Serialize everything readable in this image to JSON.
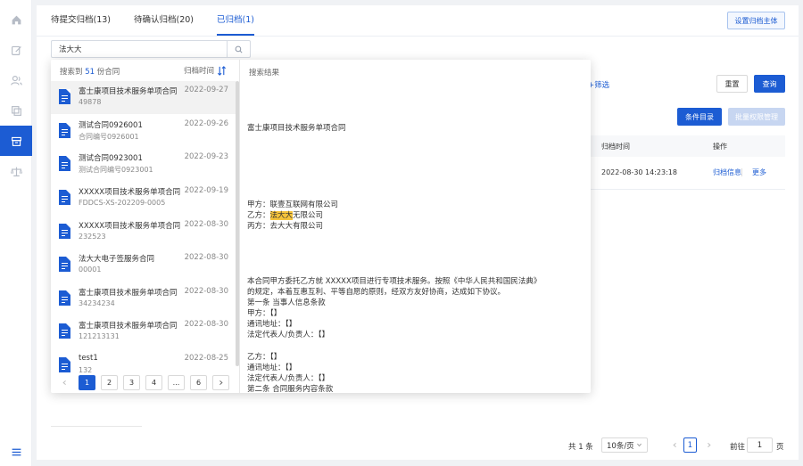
{
  "tabs": [
    {
      "label": "待提交归档(13)"
    },
    {
      "label": "待确认归档(20)"
    },
    {
      "label": "已归档(1)"
    }
  ],
  "header": {
    "set_archive_subject": "设置归档主体"
  },
  "search": {
    "value": "法大大",
    "placeholder": ""
  },
  "filter": {
    "label": "+筛选"
  },
  "buttons": {
    "reset": "重置",
    "query": "查询",
    "condition_catalog": "条件目录",
    "batch_permission": "批量权限管理"
  },
  "table": {
    "headers": [
      "归档时间",
      "操作"
    ],
    "rows": [
      {
        "archive_time": "2022-08-30 14:23:18",
        "archive_info": "归档信息",
        "more": "更多"
      }
    ]
  },
  "pagination": {
    "total": "共 1 条",
    "page_size": "10条/页",
    "current": "1",
    "goto_label": "前往",
    "goto_value": "1",
    "page_unit": "页"
  },
  "dropdown": {
    "summary_prefix": "搜索到",
    "summary_count": "51",
    "summary_suffix": "份合同",
    "sort_label": "归档时间",
    "items": [
      {
        "title": "富士康项目技术服务单项合同",
        "sub": "49878",
        "date": "2022-09-27"
      },
      {
        "title": "测试合同0926001",
        "sub": "合同编号0926001",
        "date": "2022-09-26"
      },
      {
        "title": "测试合同0923001",
        "sub": "测试合同编号0923001",
        "date": "2022-09-23"
      },
      {
        "title": "XXXXX项目技术服务单项合同",
        "sub": "FDDCS-XS-202209-0005",
        "date": "2022-09-19"
      },
      {
        "title": "XXXXX项目技术服务单项合同",
        "sub": "232523",
        "date": "2022-08-30"
      },
      {
        "title": "法大大电子签服务合同",
        "sub": "00001",
        "date": "2022-08-30"
      },
      {
        "title": "富士康项目技术服务单项合同",
        "sub": "34234234",
        "date": "2022-08-30"
      },
      {
        "title": "富士康项目技术服务单项合同",
        "sub": "121213131",
        "date": "2022-08-30"
      },
      {
        "title": "test1",
        "sub": "132",
        "date": "2022-08-25"
      }
    ],
    "pages": [
      "1",
      "2",
      "3",
      "4",
      "...",
      "6"
    ],
    "result_title": "搜索结果",
    "doc": {
      "heading": "富士康项目技术服务单项合同",
      "party_a": "甲方：联壹互联网有限公司",
      "party_b_prefix": "乙方：",
      "party_b_highlight": "法大大",
      "party_b_suffix": "无限公司",
      "party_c": "丙方：去大大有限公司",
      "para1": "本合同甲方委托乙方就 XXXXX项目进行专项技术服务。按照《中华人民共和国民法典》",
      "para2": "的规定，本着互惠互利、平等自愿的原则，经双方友好协商，达成如下协议。",
      "clause1": "第一条 当事人信息条款",
      "a_label": "甲方：【】",
      "a_addr": "通讯地址：【】",
      "a_rep": "法定代表人/负责人：【】",
      "b_label": "乙方：【】",
      "b_addr": "通讯地址：【】",
      "b_rep": "法定代表人/负责人：【】",
      "clause2": "第二条 合同服务内容条款"
    }
  }
}
